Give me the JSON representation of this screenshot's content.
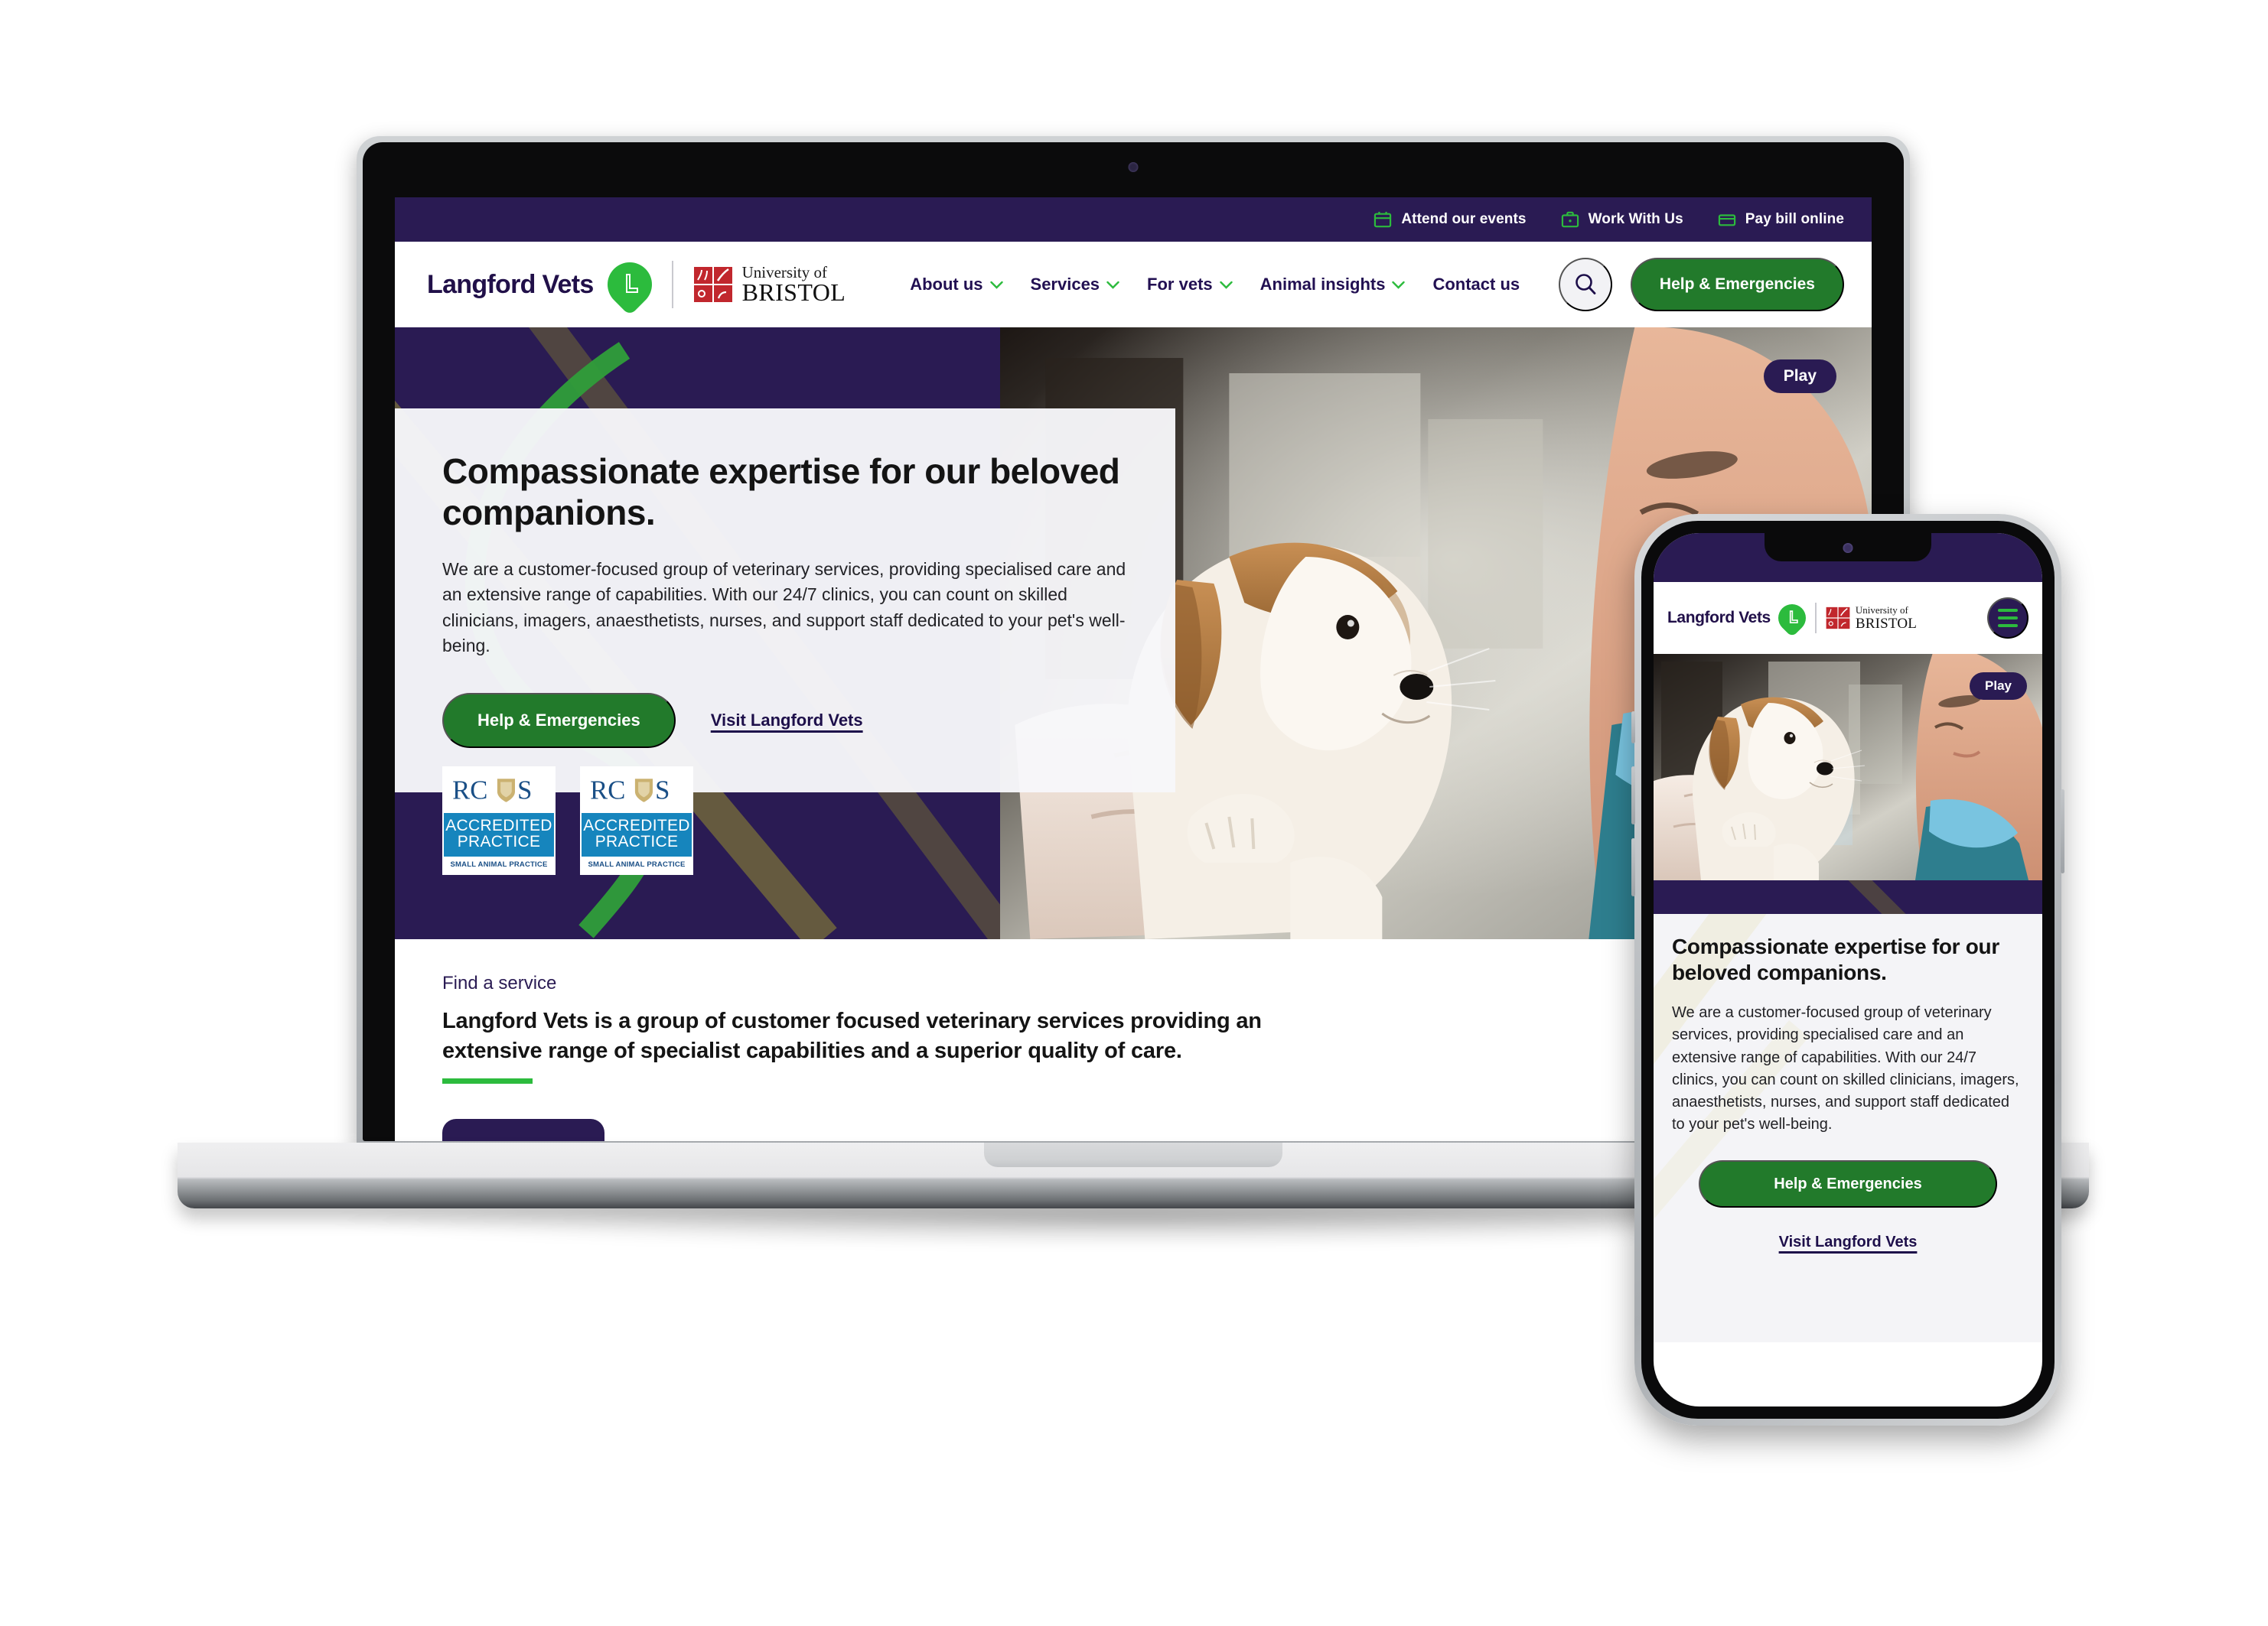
{
  "utility_bar": {
    "links": [
      {
        "label": "Attend our events",
        "icon": "calendar-icon"
      },
      {
        "label": "Work With Us",
        "icon": "briefcase-icon"
      },
      {
        "label": "Pay bill online",
        "icon": "credit-card-icon"
      }
    ]
  },
  "brand": {
    "name": "Langford Vets",
    "partner_line1": "University of",
    "partner_line2": "BRISTOL",
    "leaf_icon": "langford-leaf-icon",
    "crest_icon": "bristol-crest-icon"
  },
  "nav": {
    "items": [
      {
        "label": "About us",
        "has_dropdown": true
      },
      {
        "label": "Services",
        "has_dropdown": true
      },
      {
        "label": "For vets",
        "has_dropdown": true
      },
      {
        "label": "Animal insights",
        "has_dropdown": true
      },
      {
        "label": "Contact us",
        "has_dropdown": false
      }
    ],
    "search_icon": "search-icon",
    "cta_label": "Help & Emergencies"
  },
  "hero": {
    "heading": "Compassionate expertise for our beloved companions.",
    "body": "We are a customer-focused group of veterinary services, providing specialised care and an extensive range of capabilities. With our 24/7 clinics, you can count on skilled clinicians, imagers, anaesthetists, nurses, and support staff dedicated to your pet's well-being.",
    "primary_cta": "Help & Emergencies",
    "secondary_link": "Visit Langford Vets",
    "play_label": "Play",
    "badges": [
      {
        "title": "RCVS",
        "middle_line1": "ACCREDITED",
        "middle_line2": "PRACTICE",
        "footer": "SMALL ANIMAL PRACTICE"
      },
      {
        "title": "RCVS",
        "middle_line1": "ACCREDITED",
        "middle_line2": "PRACTICE",
        "footer": "SMALL ANIMAL PRACTICE"
      }
    ]
  },
  "service_band": {
    "eyebrow": "Find a service",
    "heading": "Langford Vets is a group of customer focused veterinary services providing an extensive range of specialist capabilities and a superior quality of care."
  },
  "phone": {
    "menu_icon": "hamburger-menu-icon",
    "play_label": "Play",
    "heading": "Compassionate expertise for our beloved companions.",
    "body": "We are a customer-focused group of veterinary services, providing specialised care and an extensive range of capabilities. With our 24/7 clinics, you can count on skilled clinicians, imagers, anaesthetists, nurses, and support staff dedicated to your pet's well-being.",
    "primary_cta": "Help & Emergencies",
    "secondary_link": "Visit Langford Vets"
  },
  "colors": {
    "purple": "#2a1b53",
    "green_accent": "#2cbb3d",
    "green_button": "#227a2b",
    "navy_text": "#211049",
    "badge_blue": "#1685bd"
  }
}
